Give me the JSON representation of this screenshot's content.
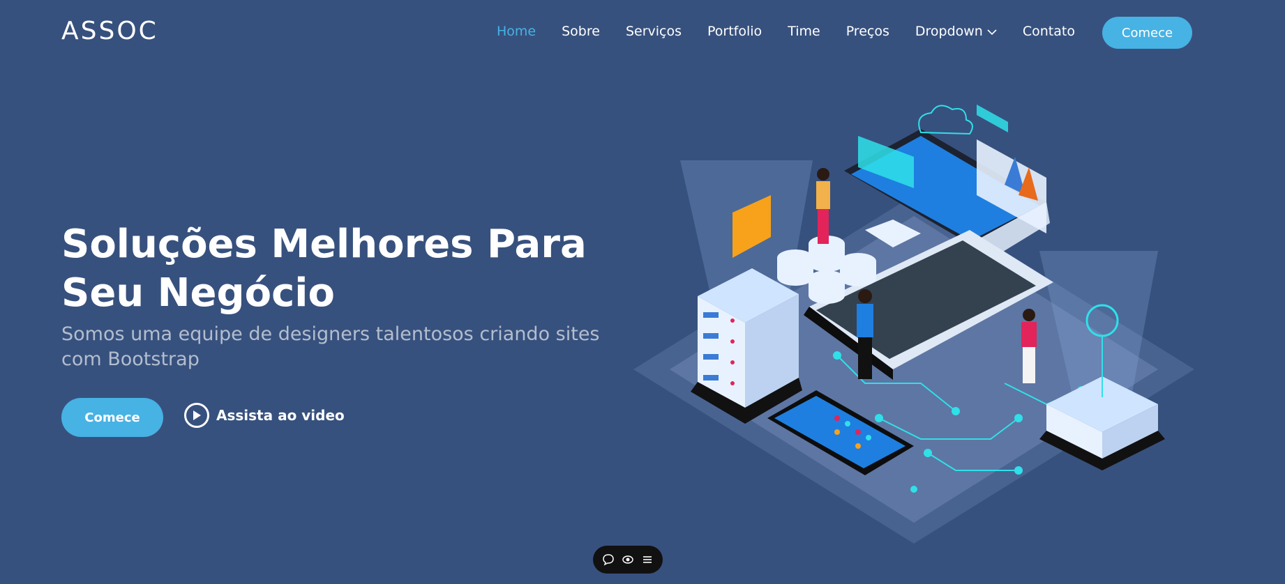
{
  "brand": {
    "logo": "ASSOC"
  },
  "nav": {
    "items": [
      {
        "label": "Home",
        "active": true
      },
      {
        "label": "Sobre"
      },
      {
        "label": "Serviços"
      },
      {
        "label": "Portfolio"
      },
      {
        "label": "Time"
      },
      {
        "label": "Preços"
      },
      {
        "label": "Dropdown",
        "icon": "chevron-down-icon"
      },
      {
        "label": "Contato"
      }
    ],
    "cta_label": "Comece"
  },
  "hero": {
    "title": "Soluções Melhores Para Seu Negócio",
    "subtitle": "Somos uma equipe de designers talentosos criando sites com Bootstrap",
    "cta_label": "Comece",
    "video_label": "Assista ao video",
    "video_icon": "play-icon"
  },
  "floating_toolbar": {
    "icons": [
      "chat-icon",
      "eye-icon",
      "menu-icon"
    ]
  },
  "colors": {
    "background": "#37517e",
    "accent": "#47b2e4",
    "text": "#ffffff",
    "toolbar": "#111111"
  }
}
